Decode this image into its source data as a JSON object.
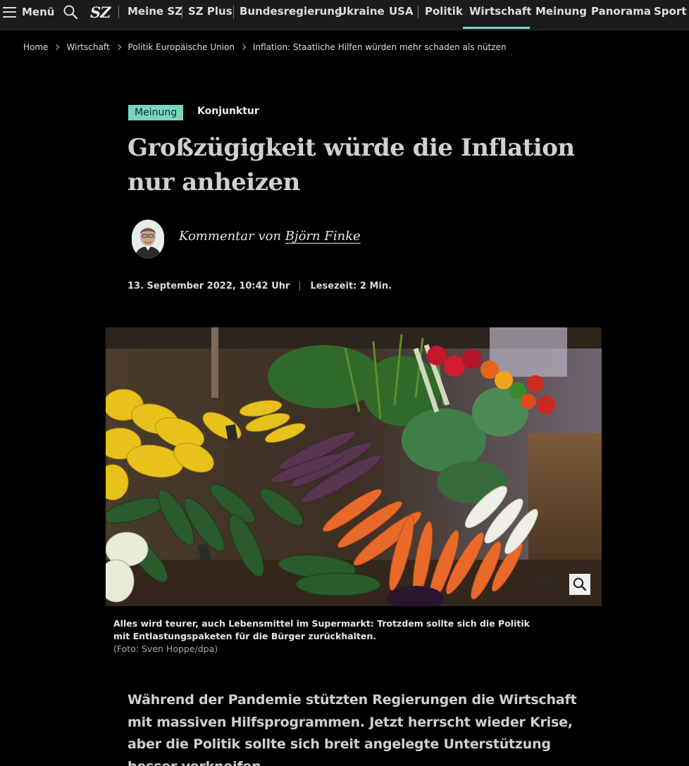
{
  "nav": {
    "menu_label": "Menü",
    "logo_text": "SZ",
    "items": [
      "Meine SZ",
      "SZ Plus",
      "Bundesregierung",
      "Ukraine",
      "USA",
      "Politik",
      "Wirtschaft",
      "Meinung",
      "Panorama",
      "Sport"
    ],
    "active_item": "Wirtschaft",
    "active_color": "#7bd4c0"
  },
  "breadcrumb": [
    "Home",
    "Wirtschaft",
    "Politik Europäische Union",
    "Inflation: Staatliche Hilfen würden mehr schaden als nützen"
  ],
  "article": {
    "badge": "Meinung",
    "topic": "Konjunktur",
    "headline": "Großzügigkeit würde die Inflation nur anheizen",
    "byline_prefix": "Kommentar von ",
    "author": "Björn Finke",
    "date": "13. September 2022, 10:42 Uhr",
    "reading_time": "Lesezeit: 2 Min.",
    "image_caption": "Alles wird teurer, auch Lebensmittel im Supermarkt: Trotzdem sollte sich die Politik mit Entlastungspaketen für die Bürger zurückhalten.",
    "image_credit": "(Foto: Sven Hoppe/dpa)",
    "lead": "Während der Pandemie stützten Regierungen die Wirtschaft mit massiven Hilfsprogrammen. Jetzt herrscht wieder Krise, aber die Politik sollte sich breit angelegte Unterstützung besser verkneifen."
  },
  "icons": [
    "hamburger-icon",
    "search-icon",
    "chevron-right-icon",
    "zoom-icon"
  ]
}
